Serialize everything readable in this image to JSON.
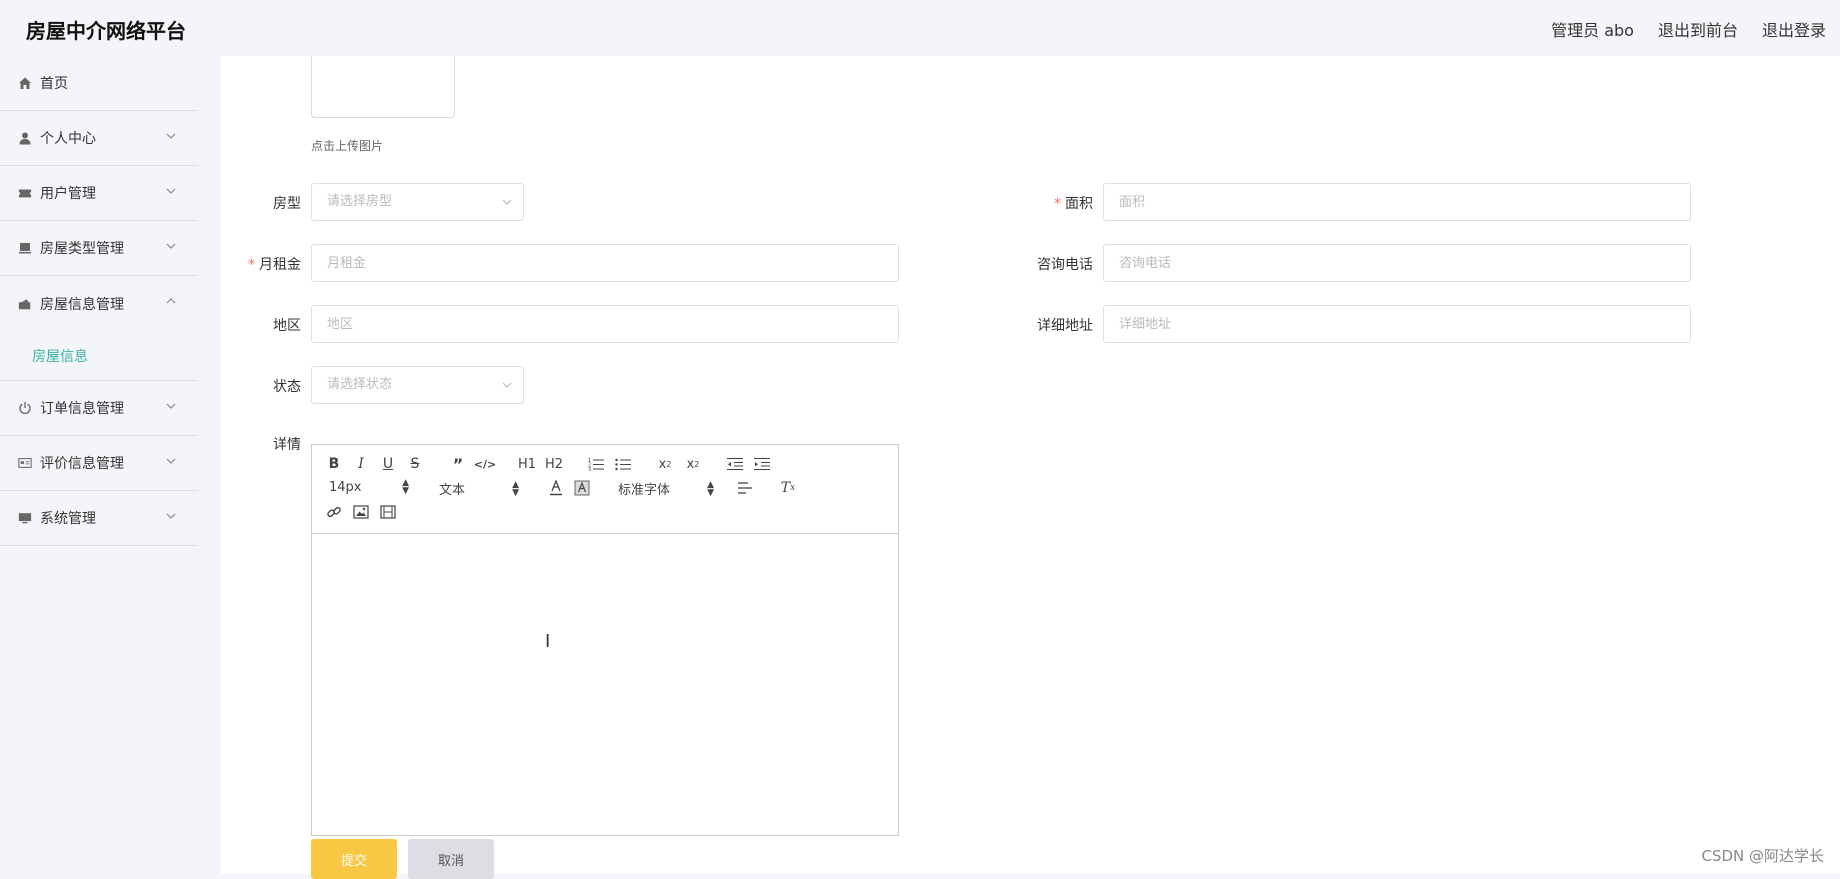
{
  "header": {
    "brand": "房屋中介网络平台",
    "admin": "管理员 abo",
    "to_front": "退出到前台",
    "logout": "退出登录"
  },
  "sidebar": {
    "items": [
      {
        "label": "首页",
        "icon": "home-icon"
      },
      {
        "label": "个人中心",
        "icon": "user-icon"
      },
      {
        "label": "用户管理",
        "icon": "ticket-icon"
      },
      {
        "label": "房屋类型管理",
        "icon": "monitor-icon"
      },
      {
        "label": "房屋信息管理",
        "icon": "wallet-icon",
        "expanded": true,
        "sub": "房屋信息"
      },
      {
        "label": "订单信息管理",
        "icon": "power-icon"
      },
      {
        "label": "评价信息管理",
        "icon": "card-icon"
      },
      {
        "label": "系统管理",
        "icon": "desktop-icon"
      }
    ]
  },
  "form": {
    "upload_tip": "点击上传图片",
    "huxing_label": "房型",
    "huxing_placeholder": "请选择房型",
    "mianji_label": "面积",
    "mianji_placeholder": "面积",
    "yuezujin_label": "月租金",
    "yuezujin_placeholder": "月租金",
    "dianhua_label": "咨询电话",
    "dianhua_placeholder": "咨询电话",
    "diqu_label": "地区",
    "diqu_placeholder": "地区",
    "dizhi_label": "详细地址",
    "dizhi_placeholder": "详细地址",
    "zhuangtai_label": "状态",
    "zhuangtai_placeholder": "请选择状态",
    "xiangqing_label": "详情",
    "required_mark": "*",
    "submit": "提交",
    "cancel": "取消"
  },
  "editor": {
    "font_size": "14px",
    "header_select": "文本",
    "font_family": "标准字体",
    "h1": "H1",
    "h2": "H2"
  },
  "watermark": "CSDN @阿达学长",
  "colors": {
    "accent": "#3bb3a4",
    "submit": "#f7c843",
    "required": "#f56c6c"
  }
}
